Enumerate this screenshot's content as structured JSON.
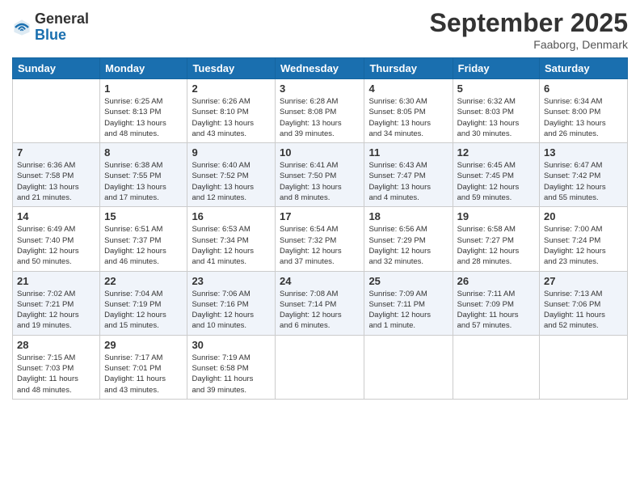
{
  "header": {
    "logo": {
      "general": "General",
      "blue": "Blue"
    },
    "title": "September 2025",
    "location": "Faaborg, Denmark"
  },
  "weekdays": [
    "Sunday",
    "Monday",
    "Tuesday",
    "Wednesday",
    "Thursday",
    "Friday",
    "Saturday"
  ],
  "weeks": [
    [
      {
        "day": "",
        "info": ""
      },
      {
        "day": "1",
        "info": "Sunrise: 6:25 AM\nSunset: 8:13 PM\nDaylight: 13 hours\nand 48 minutes."
      },
      {
        "day": "2",
        "info": "Sunrise: 6:26 AM\nSunset: 8:10 PM\nDaylight: 13 hours\nand 43 minutes."
      },
      {
        "day": "3",
        "info": "Sunrise: 6:28 AM\nSunset: 8:08 PM\nDaylight: 13 hours\nand 39 minutes."
      },
      {
        "day": "4",
        "info": "Sunrise: 6:30 AM\nSunset: 8:05 PM\nDaylight: 13 hours\nand 34 minutes."
      },
      {
        "day": "5",
        "info": "Sunrise: 6:32 AM\nSunset: 8:03 PM\nDaylight: 13 hours\nand 30 minutes."
      },
      {
        "day": "6",
        "info": "Sunrise: 6:34 AM\nSunset: 8:00 PM\nDaylight: 13 hours\nand 26 minutes."
      }
    ],
    [
      {
        "day": "7",
        "info": "Sunrise: 6:36 AM\nSunset: 7:58 PM\nDaylight: 13 hours\nand 21 minutes."
      },
      {
        "day": "8",
        "info": "Sunrise: 6:38 AM\nSunset: 7:55 PM\nDaylight: 13 hours\nand 17 minutes."
      },
      {
        "day": "9",
        "info": "Sunrise: 6:40 AM\nSunset: 7:52 PM\nDaylight: 13 hours\nand 12 minutes."
      },
      {
        "day": "10",
        "info": "Sunrise: 6:41 AM\nSunset: 7:50 PM\nDaylight: 13 hours\nand 8 minutes."
      },
      {
        "day": "11",
        "info": "Sunrise: 6:43 AM\nSunset: 7:47 PM\nDaylight: 13 hours\nand 4 minutes."
      },
      {
        "day": "12",
        "info": "Sunrise: 6:45 AM\nSunset: 7:45 PM\nDaylight: 12 hours\nand 59 minutes."
      },
      {
        "day": "13",
        "info": "Sunrise: 6:47 AM\nSunset: 7:42 PM\nDaylight: 12 hours\nand 55 minutes."
      }
    ],
    [
      {
        "day": "14",
        "info": "Sunrise: 6:49 AM\nSunset: 7:40 PM\nDaylight: 12 hours\nand 50 minutes."
      },
      {
        "day": "15",
        "info": "Sunrise: 6:51 AM\nSunset: 7:37 PM\nDaylight: 12 hours\nand 46 minutes."
      },
      {
        "day": "16",
        "info": "Sunrise: 6:53 AM\nSunset: 7:34 PM\nDaylight: 12 hours\nand 41 minutes."
      },
      {
        "day": "17",
        "info": "Sunrise: 6:54 AM\nSunset: 7:32 PM\nDaylight: 12 hours\nand 37 minutes."
      },
      {
        "day": "18",
        "info": "Sunrise: 6:56 AM\nSunset: 7:29 PM\nDaylight: 12 hours\nand 32 minutes."
      },
      {
        "day": "19",
        "info": "Sunrise: 6:58 AM\nSunset: 7:27 PM\nDaylight: 12 hours\nand 28 minutes."
      },
      {
        "day": "20",
        "info": "Sunrise: 7:00 AM\nSunset: 7:24 PM\nDaylight: 12 hours\nand 23 minutes."
      }
    ],
    [
      {
        "day": "21",
        "info": "Sunrise: 7:02 AM\nSunset: 7:21 PM\nDaylight: 12 hours\nand 19 minutes."
      },
      {
        "day": "22",
        "info": "Sunrise: 7:04 AM\nSunset: 7:19 PM\nDaylight: 12 hours\nand 15 minutes."
      },
      {
        "day": "23",
        "info": "Sunrise: 7:06 AM\nSunset: 7:16 PM\nDaylight: 12 hours\nand 10 minutes."
      },
      {
        "day": "24",
        "info": "Sunrise: 7:08 AM\nSunset: 7:14 PM\nDaylight: 12 hours\nand 6 minutes."
      },
      {
        "day": "25",
        "info": "Sunrise: 7:09 AM\nSunset: 7:11 PM\nDaylight: 12 hours\nand 1 minute."
      },
      {
        "day": "26",
        "info": "Sunrise: 7:11 AM\nSunset: 7:09 PM\nDaylight: 11 hours\nand 57 minutes."
      },
      {
        "day": "27",
        "info": "Sunrise: 7:13 AM\nSunset: 7:06 PM\nDaylight: 11 hours\nand 52 minutes."
      }
    ],
    [
      {
        "day": "28",
        "info": "Sunrise: 7:15 AM\nSunset: 7:03 PM\nDaylight: 11 hours\nand 48 minutes."
      },
      {
        "day": "29",
        "info": "Sunrise: 7:17 AM\nSunset: 7:01 PM\nDaylight: 11 hours\nand 43 minutes."
      },
      {
        "day": "30",
        "info": "Sunrise: 7:19 AM\nSunset: 6:58 PM\nDaylight: 11 hours\nand 39 minutes."
      },
      {
        "day": "",
        "info": ""
      },
      {
        "day": "",
        "info": ""
      },
      {
        "day": "",
        "info": ""
      },
      {
        "day": "",
        "info": ""
      }
    ]
  ]
}
